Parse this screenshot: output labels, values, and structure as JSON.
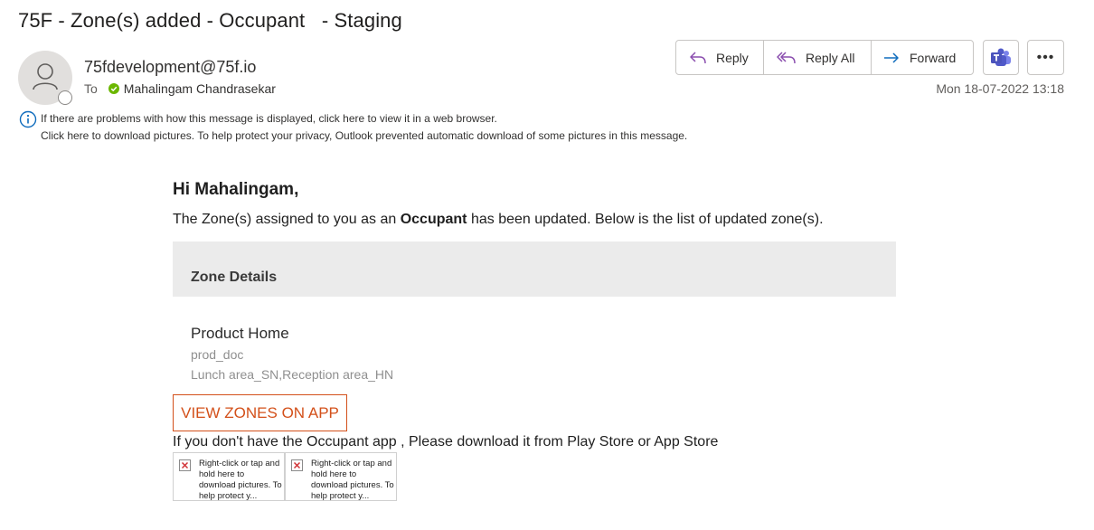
{
  "email": {
    "subject": "75F - Zone(s) added - Occupant   - Staging",
    "sender": "75fdevelopment@75f.io",
    "to_label": "To",
    "recipient": "Mahalingam Chandrasekar",
    "date": "Mon 18-07-2022 13:18"
  },
  "actions": {
    "reply": "Reply",
    "reply_all": "Reply All",
    "forward": "Forward",
    "more": "•••"
  },
  "infobar": {
    "line1": "If there are problems with how this message is displayed, click here to view it in a web browser.",
    "line2": "Click here to download pictures. To help protect your privacy, Outlook prevented automatic download of some pictures in this message."
  },
  "body": {
    "greeting": "Hi Mahalingam,",
    "intro_before": "The Zone(s) assigned to you as an ",
    "intro_bold": "Occupant",
    "intro_after": " has been updated. Below is the list of updated zone(s).",
    "zone_details_heading": "Zone Details",
    "zone_name": "Product Home",
    "zone_sub1": "prod_doc",
    "zone_sub2": "Lunch area_SN,Reception area_HN",
    "view_button": "VIEW ZONES ON APP",
    "download_text": "If you don't have the Occupant app , Please download it from Play Store or App Store",
    "placeholder_text": "Right-click or tap and hold here to download pictures. To help protect y..."
  },
  "colors": {
    "accent_orange": "#d3501a",
    "presence_green": "#6bb700",
    "outlook_blue": "#0f6cbd",
    "reply_purple": "#8a4dae"
  }
}
